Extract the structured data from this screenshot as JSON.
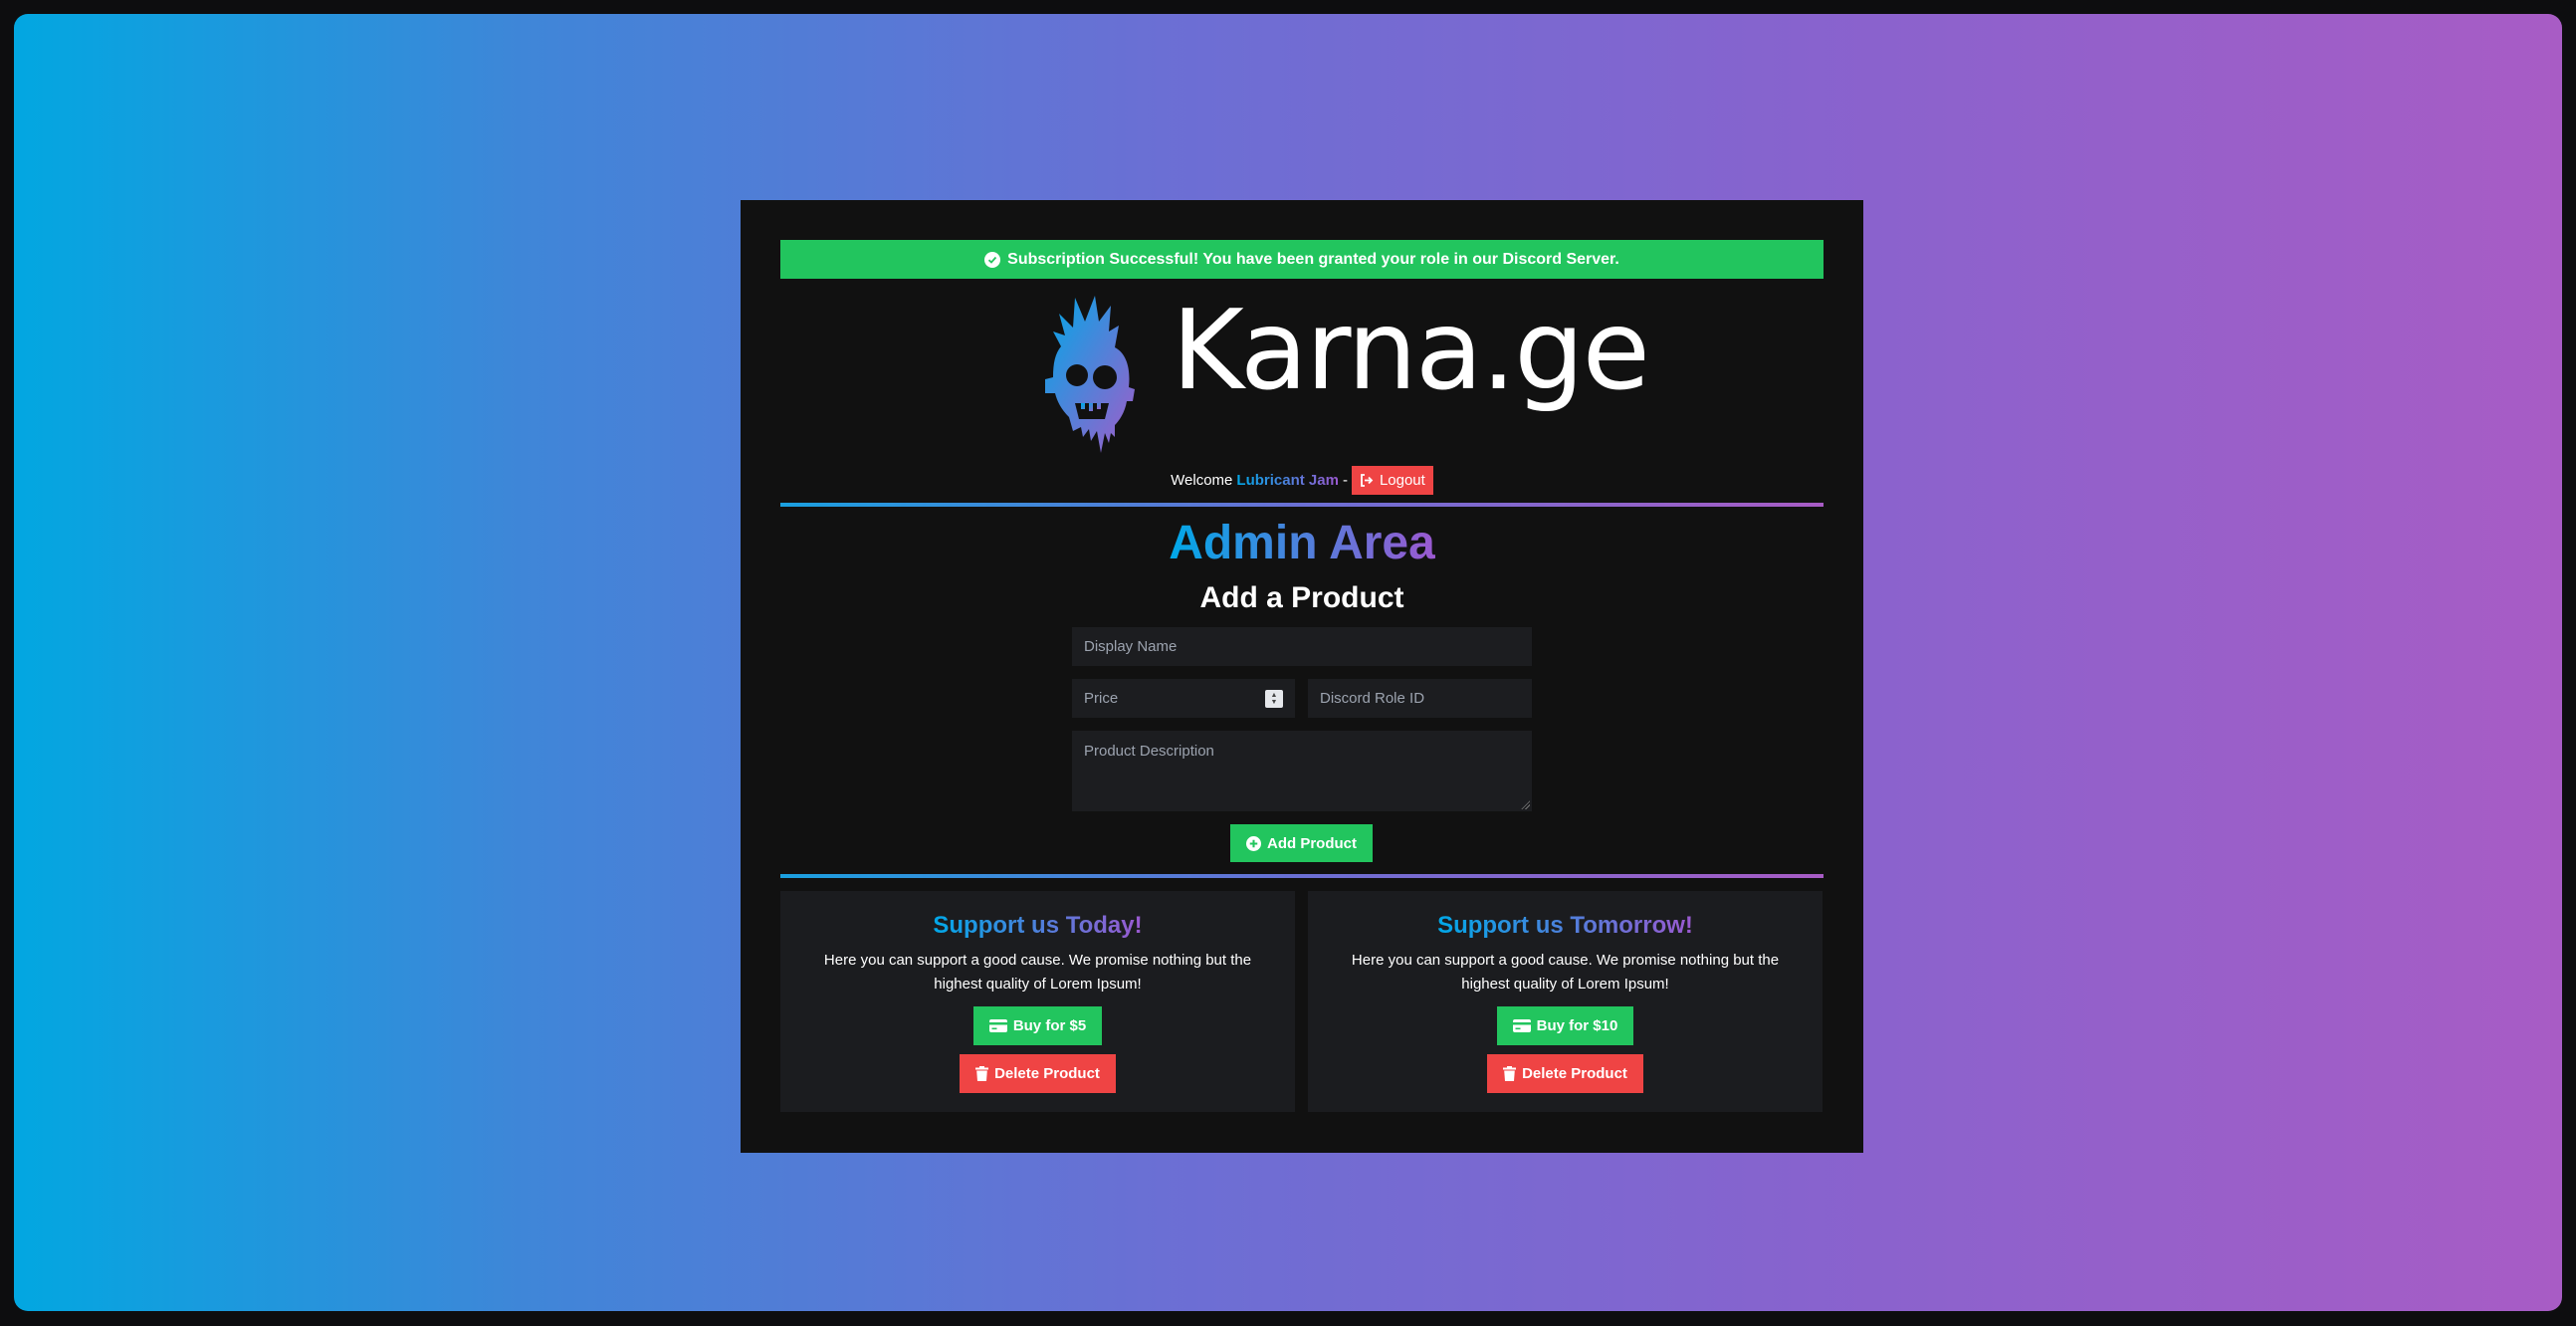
{
  "alert": {
    "message": "Subscription Successful! You have been granted your role in our Discord Server."
  },
  "brand": {
    "name": "Karna.ge"
  },
  "header": {
    "welcome_label": "Welcome",
    "username": "Lubricant Jam",
    "separator": "-",
    "logout_label": "Logout"
  },
  "admin": {
    "title": "Admin Area",
    "subtitle": "Add a Product",
    "form": {
      "display_name_placeholder": "Display Name",
      "price_placeholder": "Price",
      "role_id_placeholder": "Discord Role ID",
      "description_placeholder": "Product Description",
      "submit_label": "Add Product"
    }
  },
  "products": [
    {
      "title": "Support us Today!",
      "description": "Here you can support a good cause. We promise nothing but the highest quality of Lorem Ipsum!",
      "buy_label": "Buy for $5",
      "delete_label": "Delete Product"
    },
    {
      "title": "Support us Tomorrow!",
      "description": "Here you can support a good cause. We promise nothing but the highest quality of Lorem Ipsum!",
      "buy_label": "Buy for $10",
      "delete_label": "Delete Product"
    }
  ],
  "colors": {
    "success": "#22c55e",
    "danger": "#ef4444",
    "gradient_start": "#00a8e8",
    "gradient_end": "#9b59d0",
    "panel": "#111111"
  },
  "icons": {
    "alert": "check-circle-icon",
    "logout": "sign-out-icon",
    "add": "plus-circle-icon",
    "buy": "credit-card-icon",
    "delete": "trash-icon",
    "logo": "zombie-skull-icon"
  }
}
